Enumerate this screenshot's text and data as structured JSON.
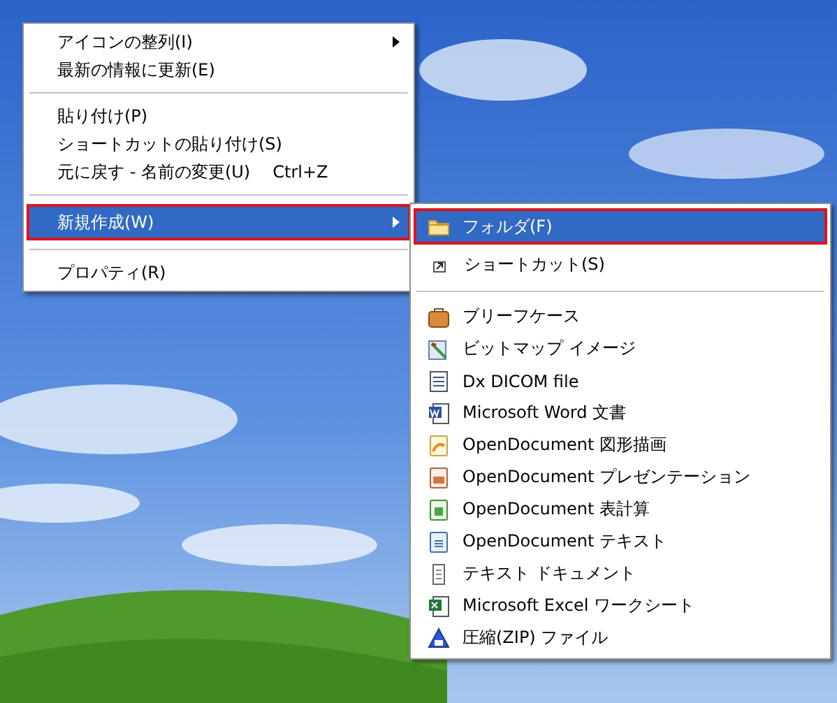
{
  "context_menu": {
    "groups": [
      {
        "items": [
          {
            "label": "アイコンの整列(I)",
            "has_submenu": true,
            "selected": false
          },
          {
            "label": "最新の情報に更新(E)",
            "has_submenu": false,
            "selected": false
          }
        ]
      },
      {
        "items": [
          {
            "label": "貼り付け(P)",
            "has_submenu": false,
            "selected": false
          },
          {
            "label": "ショートカットの貼り付け(S)",
            "has_submenu": false,
            "selected": false
          },
          {
            "label": "元に戻す - 名前の変更(U)",
            "shortcut": "Ctrl+Z",
            "has_submenu": false,
            "selected": false
          }
        ]
      },
      {
        "items": [
          {
            "label": "新規作成(W)",
            "has_submenu": true,
            "selected": true
          }
        ]
      },
      {
        "items": [
          {
            "label": "プロパティ(R)",
            "has_submenu": false,
            "selected": false
          }
        ]
      }
    ]
  },
  "submenu": {
    "groups": [
      {
        "items": [
          {
            "label": "フォルダ(F)",
            "selected": true
          },
          {
            "label": "ショートカット(S)",
            "selected": false
          }
        ]
      },
      {
        "items": [
          {
            "label": "ブリーフケース",
            "selected": false
          },
          {
            "label": "ビットマップ イメージ",
            "selected": false
          },
          {
            "label": "Dx DICOM file",
            "selected": false
          },
          {
            "label": "Microsoft Word 文書",
            "selected": false
          },
          {
            "label": "OpenDocument 図形描画",
            "selected": false
          },
          {
            "label": "OpenDocument プレゼンテーション",
            "selected": false
          },
          {
            "label": "OpenDocument 表計算",
            "selected": false
          },
          {
            "label": "OpenDocument テキスト",
            "selected": false
          },
          {
            "label": "テキスト ドキュメント",
            "selected": false
          },
          {
            "label": "Microsoft Excel ワークシート",
            "selected": false
          },
          {
            "label": "圧縮(ZIP) ファイル",
            "selected": false
          }
        ]
      }
    ]
  }
}
